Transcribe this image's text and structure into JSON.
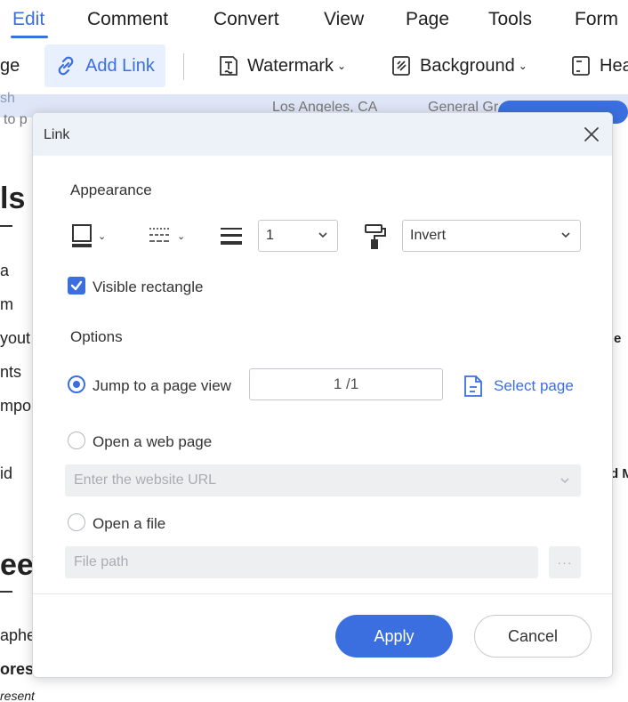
{
  "menu": {
    "items": [
      "Edit",
      "Comment",
      "Convert",
      "View",
      "Page",
      "Tools",
      "Form"
    ],
    "active": "Edit"
  },
  "toolbar": {
    "left_partial": "ge",
    "add_link": "Add Link",
    "watermark": "Watermark",
    "background": "Background",
    "header_partial": "Hea"
  },
  "document": {
    "strip_texts": [
      "sh",
      "to p",
      "Los Angeles, CA",
      "General Gr"
    ],
    "left_lines": [
      "ls",
      "a",
      "m",
      "yout",
      "nts",
      "mpo",
      "id",
      "eer",
      "aphe",
      "ores",
      "resent"
    ],
    "right_lines": [
      "e",
      "d M"
    ]
  },
  "dialog": {
    "title": "Link",
    "appearance": {
      "section_title": "Appearance",
      "line_width_value": "1",
      "highlight_value": "Invert",
      "visible_rectangle_label": "Visible rectangle",
      "visible_rectangle_checked": true
    },
    "options": {
      "section_title": "Options",
      "jump_label": "Jump to a page view",
      "page_value": "1 /1",
      "select_page": "Select page",
      "web_label": "Open a web page",
      "url_placeholder": "Enter the website URL",
      "file_label": "Open a file",
      "file_placeholder": "File path",
      "file_browse": "···",
      "selected": "jump"
    },
    "buttons": {
      "apply": "Apply",
      "cancel": "Cancel"
    }
  },
  "colors": {
    "accent": "#3b6fe0",
    "dialog_header": "#edf1f8",
    "disabled_field": "#eeeff1"
  }
}
